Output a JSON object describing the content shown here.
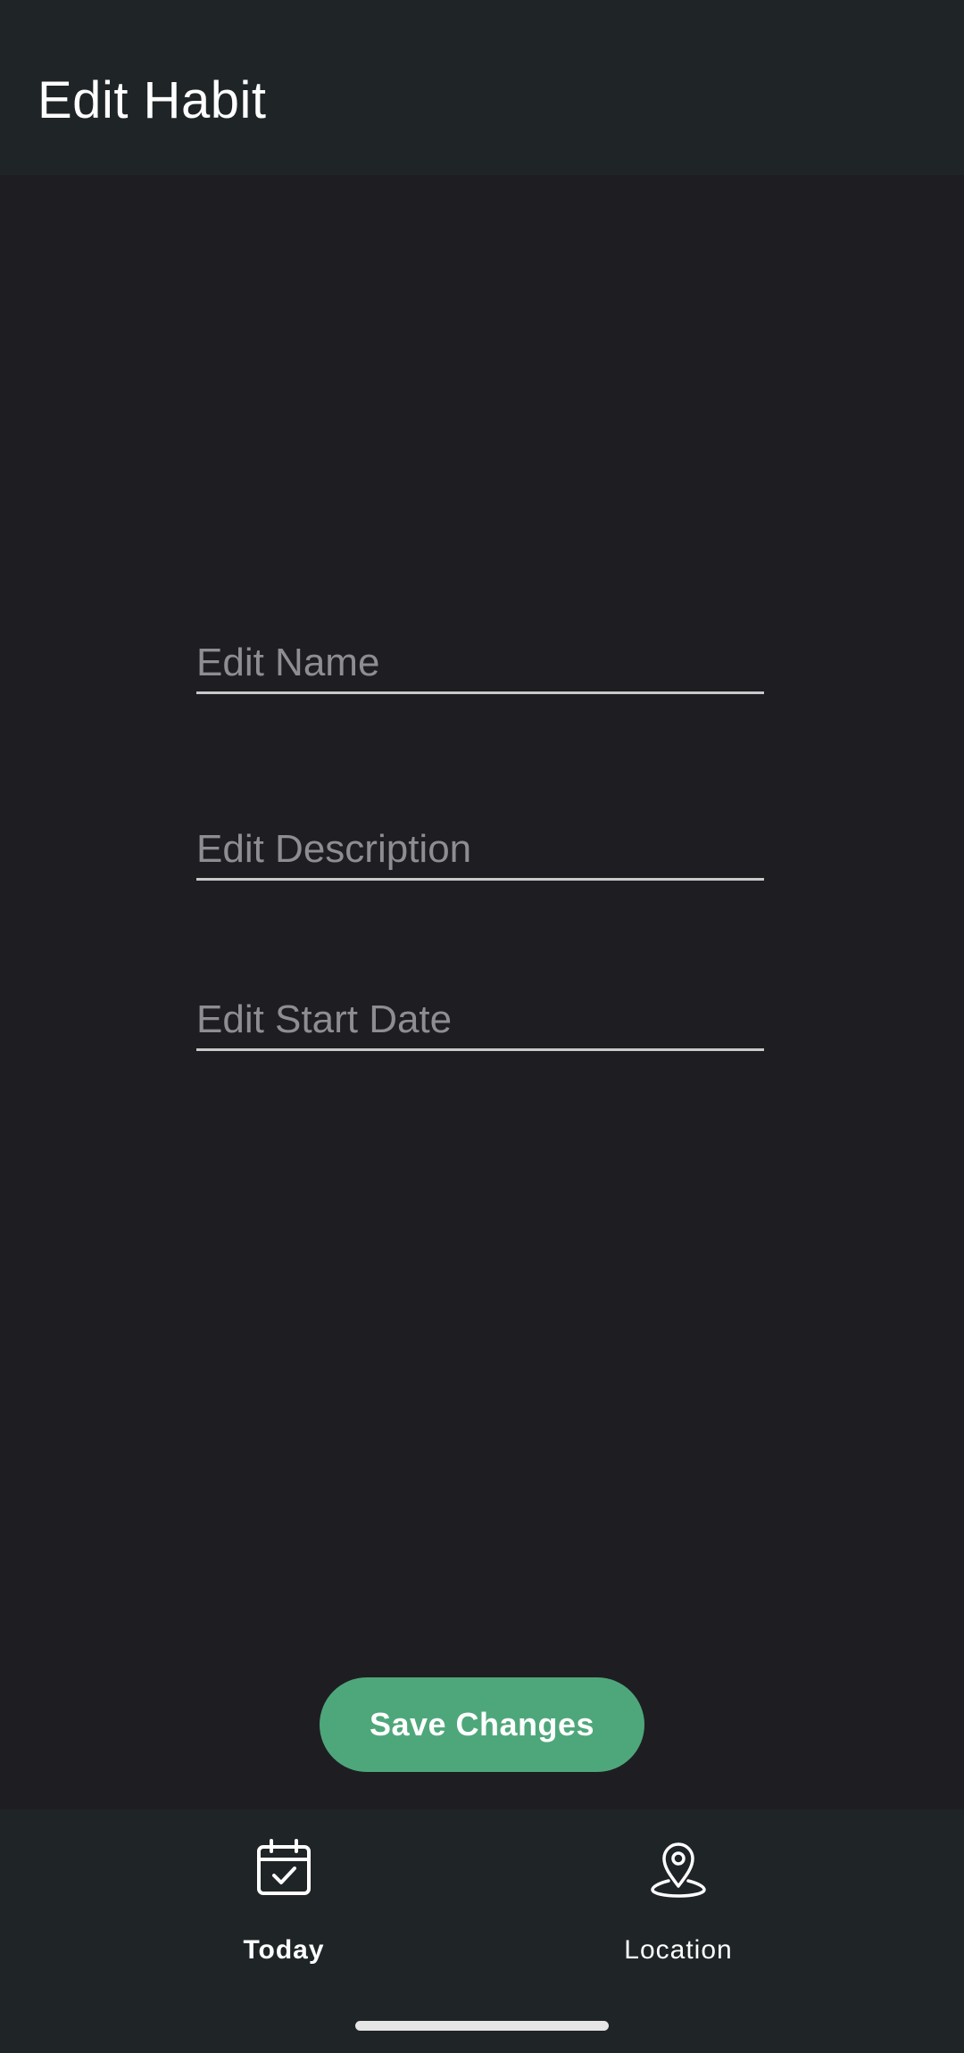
{
  "app_bar": {
    "title": "Edit Habit"
  },
  "form": {
    "name": {
      "value": "",
      "placeholder": "Edit Name"
    },
    "description": {
      "value": "",
      "placeholder": "Edit Description"
    },
    "start_date": {
      "value": "",
      "placeholder": "Edit Start Date"
    }
  },
  "actions": {
    "save_label": "Save Changes"
  },
  "bottom_nav": {
    "items": [
      {
        "label": "Today",
        "icon": "calendar-check-icon",
        "selected": true
      },
      {
        "label": "Location",
        "icon": "map-pin-icon",
        "selected": false
      }
    ]
  },
  "colors": {
    "background": "#1e1e22",
    "bar": "#1f2527",
    "accent": "#4ea77a",
    "placeholder": "#8e8e92",
    "underline": "#c9c9c9"
  }
}
